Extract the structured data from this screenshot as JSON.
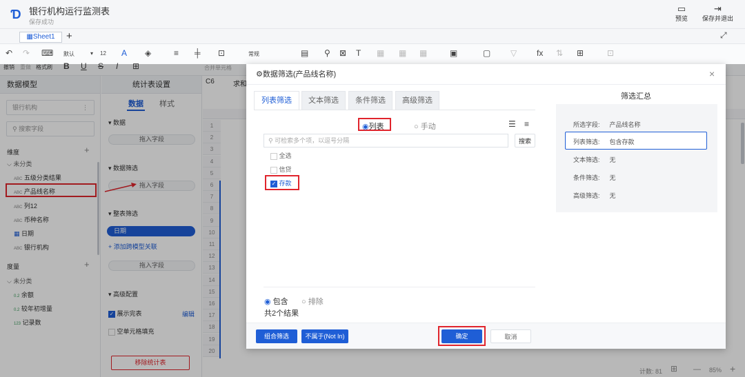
{
  "app": {
    "title": "银行机构运行监测表",
    "subtitle": "保存成功"
  },
  "titlebar_buttons": {
    "preview": "预览",
    "save_exit": "保存并退出"
  },
  "sheet": {
    "tab": "Sheet1",
    "add": "+"
  },
  "toolbar": {
    "undo": "撤销",
    "redo": "重做",
    "format_brush": "格式刷",
    "font": "默认",
    "font_size": "12",
    "bold": "B",
    "underline": "U",
    "strike": "S",
    "italic": "I",
    "merge": "合并单元格",
    "format": "常规",
    "cell_ref": "C6",
    "cell_content": "求和"
  },
  "left": {
    "header": "数据模型",
    "dataset": "银行机构",
    "search_placeholder": "搜索字段",
    "dim_title": "维度",
    "dim_group": "未分类",
    "dims": [
      {
        "icon": "ABC",
        "label": "五级分类结果"
      },
      {
        "icon": "ABC",
        "label": "产品线名称"
      },
      {
        "icon": "ABC",
        "label": "列12"
      },
      {
        "icon": "ABC",
        "label": "币种名称"
      },
      {
        "icon": "date",
        "label": "日期"
      },
      {
        "icon": "ABC",
        "label": "银行机构"
      }
    ],
    "measure_title": "度量",
    "measure_group": "未分类",
    "measures": [
      {
        "icon": "0.2",
        "label": "余额"
      },
      {
        "icon": "0.2",
        "label": "较年初增量"
      },
      {
        "icon": "123",
        "label": "记录数"
      }
    ]
  },
  "mid": {
    "header": "统计表设置",
    "tab_data": "数据",
    "tab_style": "样式",
    "sec_data": "数据",
    "drag_field": "拖入字段",
    "sec_filter": "数据筛选",
    "sec_table_filter": "整表筛选",
    "table_filter_item": "日期",
    "add_cross": "添加跨模型关联",
    "sec_advanced": "高级配置",
    "show_full": "展示完表",
    "edit": "编辑",
    "fill_empty": "空单元格填充",
    "remove": "移除统计表"
  },
  "grid": {
    "rows": [
      "1",
      "2",
      "3",
      "4",
      "5",
      "6",
      "7",
      "8",
      "9",
      "10",
      "11",
      "12",
      "13",
      "14",
      "15",
      "16",
      "17",
      "18",
      "19",
      "20"
    ]
  },
  "dialog": {
    "title": "数据筛选(产品线名称)",
    "tabs": [
      "列表筛选",
      "文本筛选",
      "条件筛选",
      "高级筛选"
    ],
    "mode_list": "列表",
    "mode_manual": "手动",
    "search_placeholder": "可检索多个项，以逗号分隔",
    "search_btn": "搜索",
    "select_all": "全选",
    "items": [
      {
        "label": "信贷",
        "checked": false
      },
      {
        "label": "存款",
        "checked": true
      }
    ],
    "include": "包含",
    "exclude": "排除",
    "result_count": "共2个结果",
    "summary_title": "筛选汇总",
    "summary": [
      {
        "k": "所选字段:",
        "v": "产品线名称"
      },
      {
        "k": "列表筛选:",
        "v": "包含存款"
      },
      {
        "k": "文本筛选:",
        "v": "无"
      },
      {
        "k": "条件筛选:",
        "v": "无"
      },
      {
        "k": "高级筛选:",
        "v": "无"
      }
    ],
    "btn_combo": "组合筛选",
    "btn_not_in": "不属于(Not In)",
    "btn_ok": "确定",
    "btn_cancel": "取消"
  },
  "status": {
    "count": "计数: 81",
    "zoom": "85%",
    "minus": "—",
    "plus": "+"
  },
  "colors": {
    "accent": "#1f5ed6",
    "highlight": "#e0242c"
  }
}
